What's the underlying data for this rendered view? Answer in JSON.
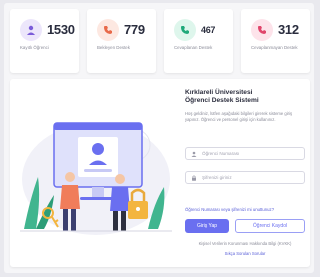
{
  "stats": [
    {
      "value": "1530",
      "label": "Kayıtlı Öğrenci",
      "icon": "user-icon",
      "color": "#7b5cd9",
      "bg": "#ece6fb"
    },
    {
      "value": "779",
      "label": "Bekleyen Destek",
      "icon": "phone-icon",
      "color": "#e86a4a",
      "bg": "#fde8e1"
    },
    {
      "value": "467",
      "label": "Cevaplanan Destek",
      "icon": "phone-check-icon",
      "color": "#1fa97a",
      "bg": "#def6ec"
    },
    {
      "value": "312",
      "label": "Cevaplanmayan Destek",
      "icon": "phone-x-icon",
      "color": "#e0456b",
      "bg": "#fde3ea"
    }
  ],
  "login": {
    "title": "Kırklareli Üniversitesi",
    "subtitle": "Öğrenci Destek Sistemi",
    "description": "Hoş geldiniz, lütfen aşağıdaki bilgileri girerek sisteme giriş yapınız. Öğrenci ve personel girişi için kullanınız.",
    "username_placeholder": "Öğrenci Numarası",
    "password_placeholder": "Şifrenizi giriniz",
    "forgot_text": "Öğrenci Numarası veya şifrenizi mi unuttunuz?",
    "login_button": "Giriş Yap",
    "register_button": "Öğrenci Kaydol",
    "kvkk_text": "Kişisel Verilerin Korunması Hakkında Bilgi (KVKK)",
    "info_text": "Sıkça Sorulan Sorular"
  },
  "colors": {
    "accent": "#6a6ff0",
    "plant": "#41b58f"
  }
}
